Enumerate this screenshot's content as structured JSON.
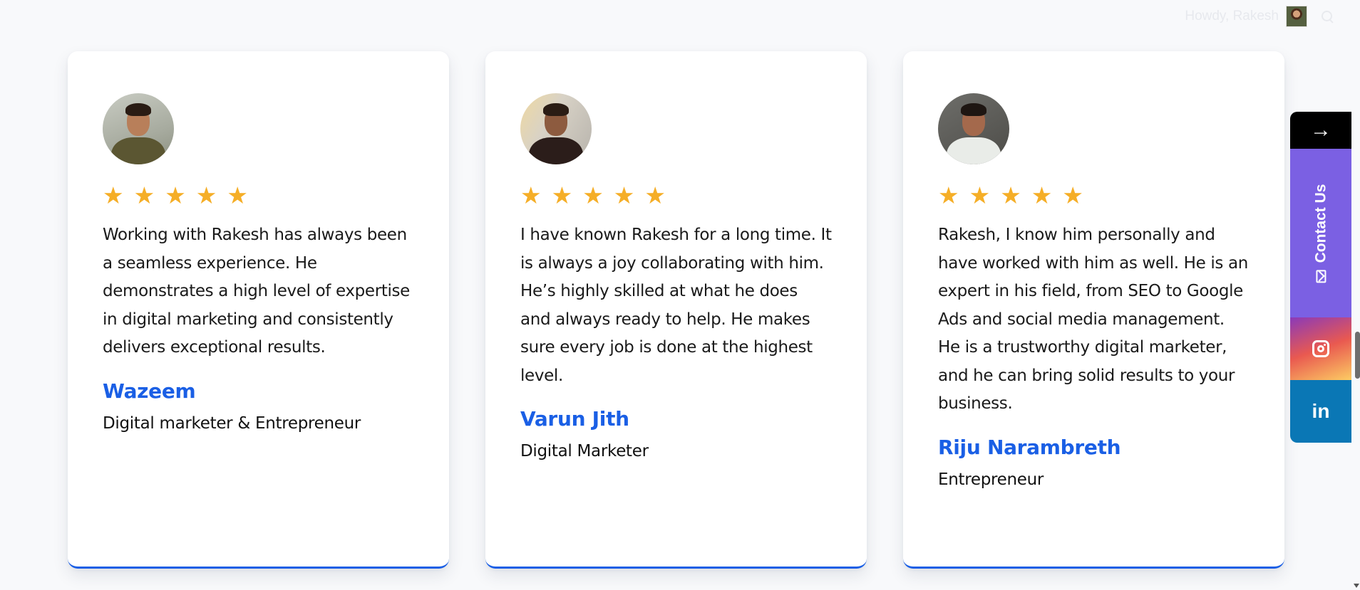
{
  "admin_bar": {
    "greeting": "Howdy, Rakesh",
    "avatar_icon": "user-avatar",
    "search_icon": "search-icon"
  },
  "colors": {
    "accent": "#1a5fe5",
    "star": "#f5ae27",
    "contact_bg": "#7b60e3",
    "linkedin_bg": "#0a77b5"
  },
  "testimonials": [
    {
      "rating": 5,
      "stars": [
        "★",
        "★",
        "★",
        "★",
        "★"
      ],
      "quote": "Working with Rakesh has always been a seamless experience. He demonstrates a high level of expertise in digital marketing and consistently delivers exceptional results.",
      "name": "Wazeem",
      "role": "Digital marketer & Entrepreneur"
    },
    {
      "rating": 5,
      "stars": [
        "★",
        "★",
        "★",
        "★",
        "★"
      ],
      "quote": "I have known Rakesh for a long time. It is always a joy collaborating with him. He’s highly skilled at what he does and always ready to help. He makes sure every job is done at the highest level.",
      "name": "Varun Jith",
      "role": "Digital Marketer"
    },
    {
      "rating": 5,
      "stars": [
        "★",
        "★",
        "★",
        "★",
        "★"
      ],
      "quote": "Rakesh, I know him personally and have worked with him as well. He is an expert in his field, from SEO to Google Ads and social media management. He is a trustworthy digital marketer, and he can bring solid results to your business.",
      "name": "Riju Narambreth",
      "role": "Entrepreneur"
    }
  ],
  "sidebar": {
    "arrow": "→",
    "contact_label": "Contact Us",
    "instagram_icon": "instagram-icon",
    "linkedin_label": "in"
  }
}
